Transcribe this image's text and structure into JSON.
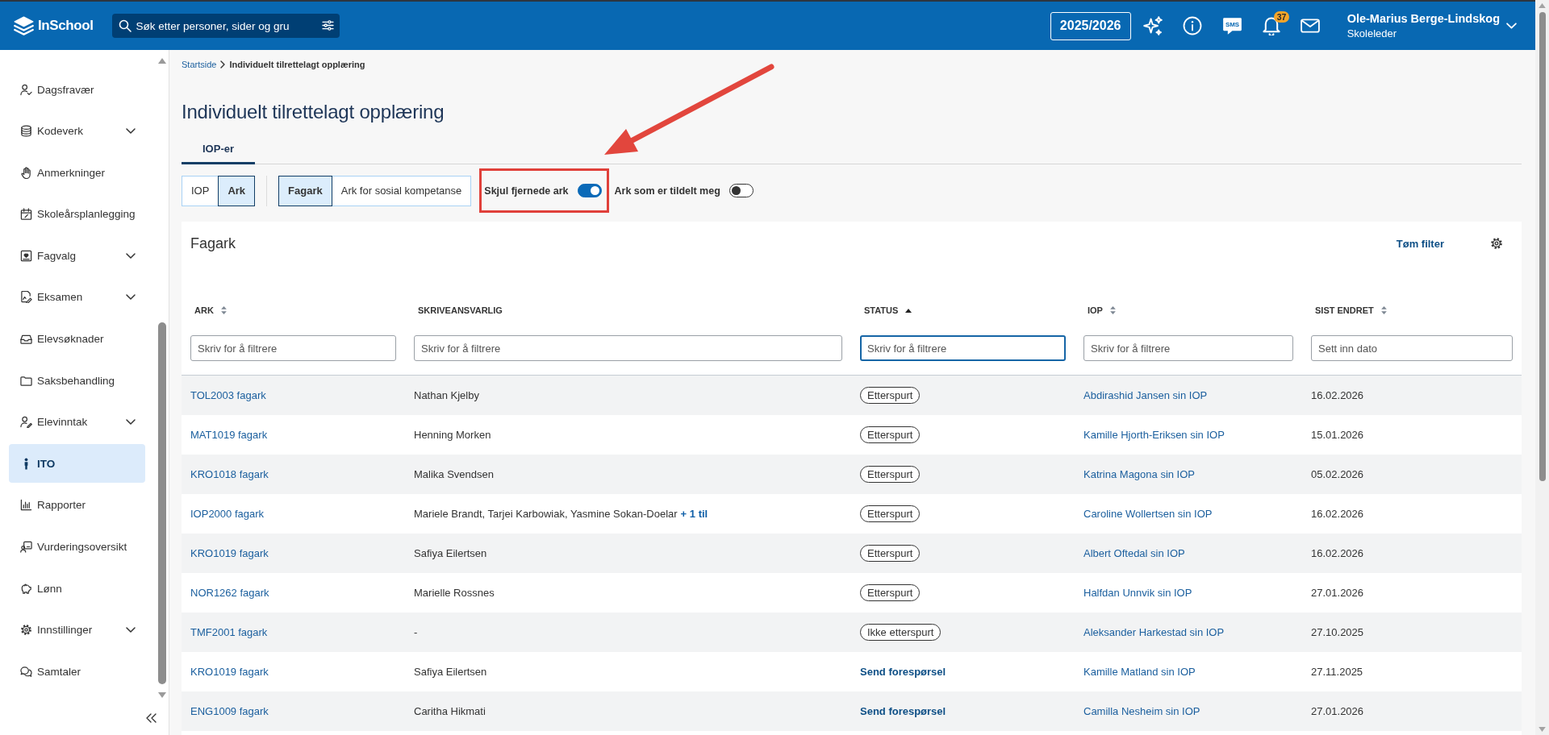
{
  "header": {
    "logo": "InSchool",
    "search": {
      "placeholder": "Søk etter personer, sider og gru"
    },
    "school_year": "2025/2026",
    "sms_label": "SMS",
    "notification_count": "37",
    "user": {
      "name": "Ole-Marius Berge-Lindskog",
      "role": "Skoleleder"
    }
  },
  "sidebar": {
    "items": [
      {
        "label": "Dagsfravær",
        "expandable": false,
        "selected": false
      },
      {
        "label": "Kodeverk",
        "expandable": true,
        "selected": false
      },
      {
        "label": "Anmerkninger",
        "expandable": false,
        "selected": false
      },
      {
        "label": "Skoleårsplanlegging",
        "expandable": false,
        "selected": false
      },
      {
        "label": "Fagvalg",
        "expandable": true,
        "selected": false
      },
      {
        "label": "Eksamen",
        "expandable": true,
        "selected": false
      },
      {
        "label": "Elevsøknader",
        "expandable": false,
        "selected": false
      },
      {
        "label": "Saksbehandling",
        "expandable": false,
        "selected": false
      },
      {
        "label": "Elevinntak",
        "expandable": true,
        "selected": false
      },
      {
        "label": "ITO",
        "expandable": false,
        "selected": true
      },
      {
        "label": "Rapporter",
        "expandable": false,
        "selected": false
      },
      {
        "label": "Vurderingsoversikt",
        "expandable": false,
        "selected": false
      },
      {
        "label": "Lønn",
        "expandable": false,
        "selected": false
      },
      {
        "label": "Innstillinger",
        "expandable": true,
        "selected": false
      },
      {
        "label": "Samtaler",
        "expandable": false,
        "selected": false
      }
    ]
  },
  "breadcrumb": [
    {
      "label": "Startside",
      "kind": "link"
    },
    {
      "label": "Individuelt tilrettelagt opplæring",
      "kind": "current"
    }
  ],
  "page_title": "Individuelt tilrettelagt opplæring",
  "tabs": [
    {
      "label": "IOP-er",
      "selected": true
    }
  ],
  "view_toggle": [
    {
      "label": "IOP",
      "selected": false
    },
    {
      "label": "Ark",
      "selected": true
    }
  ],
  "sheet_toggle": [
    {
      "label": "Fagark",
      "selected": true
    },
    {
      "label": "Ark for sosial kompetanse",
      "selected": false
    }
  ],
  "switches": [
    {
      "label": "Skjul fjernede ark",
      "on": true,
      "highlighted": true
    },
    {
      "label": "Ark som er tildelt meg",
      "on": false,
      "highlighted": false
    }
  ],
  "card": {
    "title": "Fagark",
    "clear_filter": "Tøm filter",
    "table": {
      "columns": [
        {
          "label": "ARK",
          "kind": "sortable",
          "filter": {
            "placeholder": "Skriv for å filtrere",
            "focused": false
          }
        },
        {
          "label": "SKRIVEANSVARLIG",
          "kind": "plain",
          "filter": {
            "placeholder": "Skriv for å filtrere",
            "focused": false
          }
        },
        {
          "label": "STATUS",
          "kind": "ascending",
          "filter": {
            "placeholder": "Skriv for å filtrere",
            "focused": true
          }
        },
        {
          "label": "IOP",
          "kind": "sortable",
          "filter": {
            "placeholder": "Skriv for å filtrere",
            "focused": false
          }
        },
        {
          "label": "SIST ENDRET",
          "kind": "sortable",
          "filter": {
            "placeholder": "Sett inn dato",
            "focused": false
          }
        }
      ],
      "rows": [
        {
          "ark": "TOL2003 fagark",
          "responsible": "Nathan Kjelby",
          "status": {
            "kind": "badge",
            "label": "Etterspurt"
          },
          "iop": "Abdirashid Jansen sin IOP",
          "changed": "16.02.2026"
        },
        {
          "ark": "MAT1019 fagark",
          "responsible": "Henning Morken",
          "status": {
            "kind": "badge",
            "label": "Etterspurt"
          },
          "iop": "Kamille Hjorth-Eriksen sin IOP",
          "changed": "15.01.2026"
        },
        {
          "ark": "KRO1018 fagark",
          "responsible": "Malika Svendsen",
          "status": {
            "kind": "badge",
            "label": "Etterspurt"
          },
          "iop": "Katrina Magona sin IOP",
          "changed": "05.02.2026"
        },
        {
          "ark": "IOP2000 fagark",
          "responsible": "Mariele Brandt, Tarjei Karbowiak, Yasmine Sokan-Doelar",
          "responsible_more": "+ 1 til",
          "status": {
            "kind": "badge",
            "label": "Etterspurt"
          },
          "iop": "Caroline Wollertsen sin IOP",
          "changed": "16.02.2026"
        },
        {
          "ark": "KRO1019 fagark",
          "responsible": "Safiya Eilertsen",
          "status": {
            "kind": "badge",
            "label": "Etterspurt"
          },
          "iop": "Albert Oftedal sin IOP",
          "changed": "16.02.2026"
        },
        {
          "ark": "NOR1262 fagark",
          "responsible": "Marielle Rossnes",
          "status": {
            "kind": "badge",
            "label": "Etterspurt"
          },
          "iop": "Halfdan Unnvik sin IOP",
          "changed": "27.01.2026"
        },
        {
          "ark": "TMF2001 fagark",
          "responsible": "-",
          "status": {
            "kind": "badge",
            "label": "Ikke etterspurt"
          },
          "iop": "Aleksander Harkestad sin IOP",
          "changed": "27.10.2025"
        },
        {
          "ark": "KRO1019 fagark",
          "responsible": "Safiya Eilertsen",
          "status": {
            "kind": "action",
            "label": "Send forespørsel"
          },
          "iop": "Kamille Matland sin IOP",
          "changed": "27.11.2025"
        },
        {
          "ark": "ENG1009 fagark",
          "responsible": "Caritha Hikmati",
          "status": {
            "kind": "action",
            "label": "Send forespørsel"
          },
          "iop": "Camilla Nesheim sin IOP",
          "changed": "27.01.2026"
        }
      ]
    }
  }
}
